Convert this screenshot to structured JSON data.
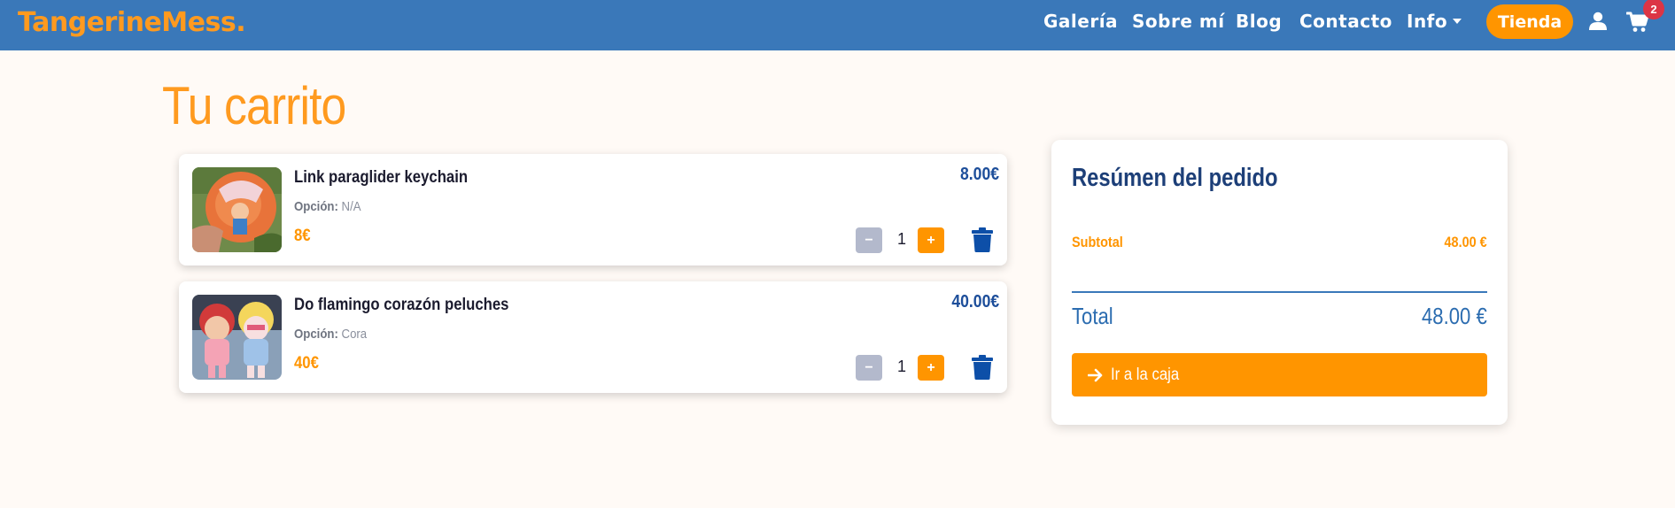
{
  "brand": "TangerineMess.",
  "nav": {
    "links": [
      "Galería",
      "Sobre mí",
      "Blog",
      "Contacto"
    ],
    "info": "Info",
    "tienda": "Tienda",
    "cart_count": "2"
  },
  "page_title": "Tu carrito",
  "cart": {
    "option_label": "Opción:",
    "items": [
      {
        "name": "Link paraglider keychain",
        "option": "N/A",
        "unit_price": "8€",
        "quantity": "1",
        "total": "8.00€"
      },
      {
        "name": "Do flamingo corazón peluches",
        "option": "Cora",
        "unit_price": "40€",
        "quantity": "1",
        "total": "40.00€"
      }
    ],
    "minus": "−",
    "plus": "+"
  },
  "summary": {
    "title": "Resúmen del pedido",
    "subtotal_label": "Subtotal",
    "subtotal_value": "48.00 €",
    "total_label": "Total",
    "total_value": "48.00 €",
    "checkout": "Ir a la caja"
  },
  "colors": {
    "navbar": "#3a78b9",
    "accent": "#ff9500",
    "price_blue": "#1d4e9a",
    "badge": "#dc3545"
  },
  "icons": [
    "user-icon",
    "shopping-cart-icon",
    "trash-icon",
    "arrow-right-icon"
  ]
}
